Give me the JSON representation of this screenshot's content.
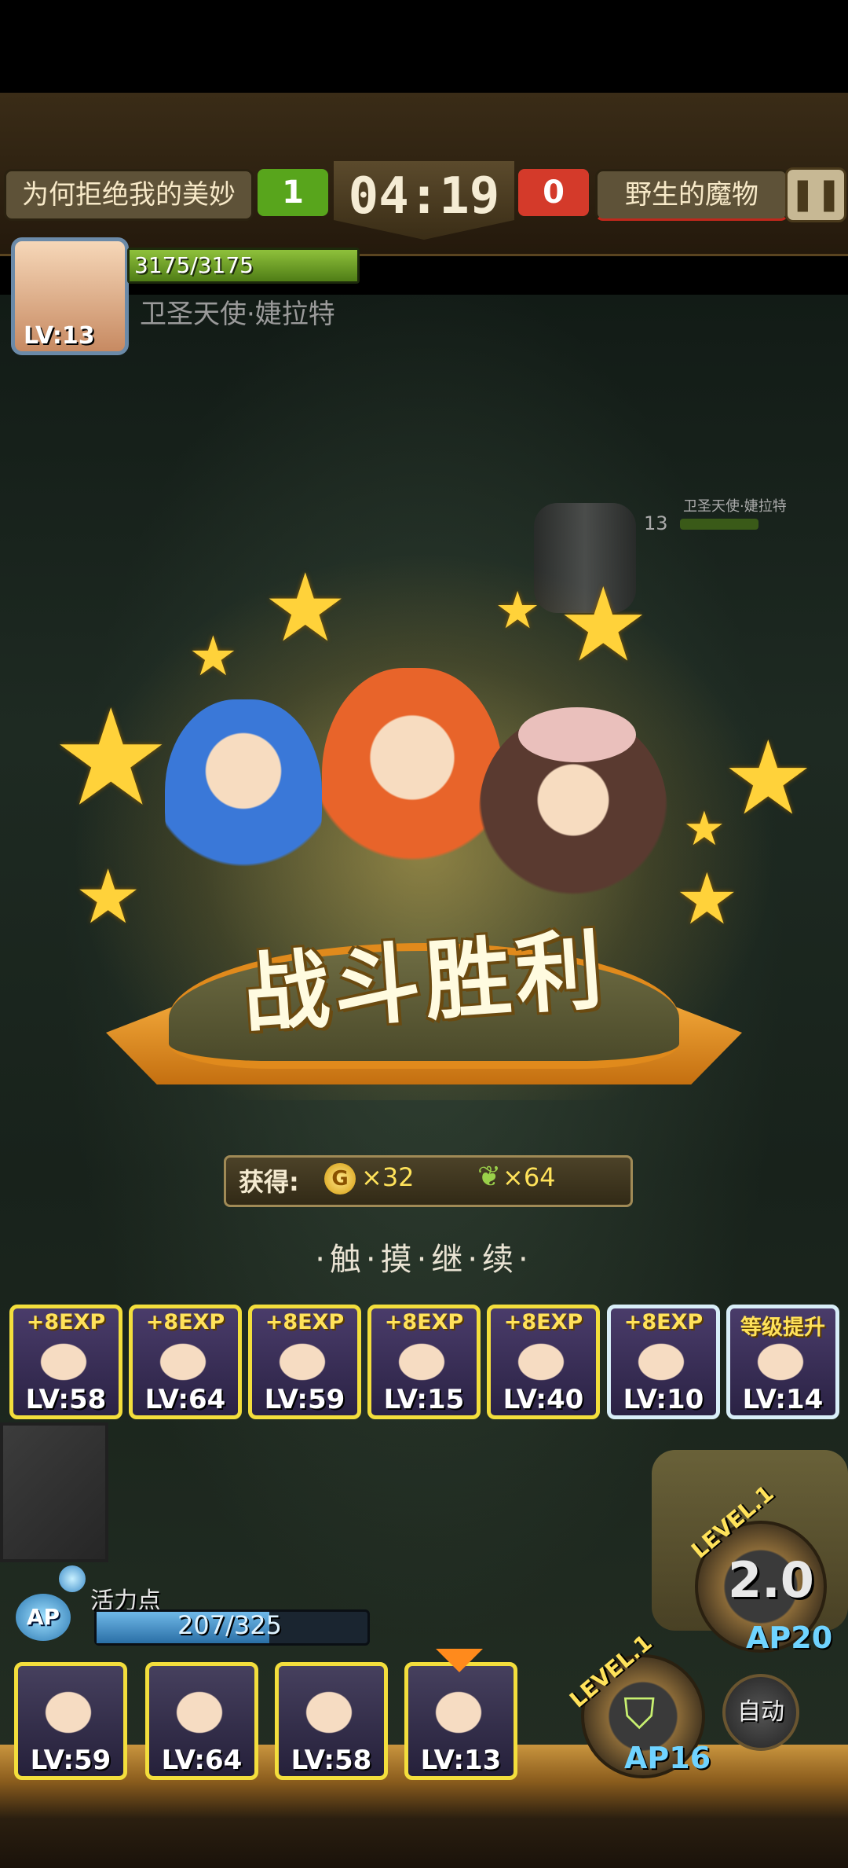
{
  "hud": {
    "left_team": "为何拒绝我的美妙",
    "left_score": "1",
    "timer": "04:19",
    "right_score": "0",
    "right_team": "野生的魔物",
    "pause_icon": "pause-icon"
  },
  "boss": {
    "hp": "3175/3175",
    "hp_fraction": 1.0,
    "name": "卫圣天使·婕拉特",
    "level": "LV:13",
    "field_level": "13",
    "field_name": "卫圣天使·婕拉特"
  },
  "victory": {
    "title": "战斗胜利",
    "reward_label": "获得:",
    "coin_icon": "G",
    "coin_amount": "×32",
    "feather_amount": "×64",
    "touch_continue": "·触·摸·继·续·"
  },
  "exp_cards": [
    {
      "label": "+8EXP",
      "level": "LV:58",
      "border": "gold"
    },
    {
      "label": "+8EXP",
      "level": "LV:64",
      "border": "gold"
    },
    {
      "label": "+8EXP",
      "level": "LV:59",
      "border": "gold"
    },
    {
      "label": "+8EXP",
      "level": "LV:15",
      "border": "gold"
    },
    {
      "label": "+8EXP",
      "level": "LV:40",
      "border": "gold"
    },
    {
      "label": "+8EXP",
      "level": "LV:10",
      "border": "silver"
    },
    {
      "label": "等级提升",
      "level": "LV:14",
      "border": "silver"
    }
  ],
  "ap": {
    "title": "活力点",
    "badge": "AP",
    "value": "207/325",
    "fraction": 0.637
  },
  "party": [
    {
      "level": "LV:59"
    },
    {
      "level": "LV:64"
    },
    {
      "level": "LV:58"
    },
    {
      "level": "LV:13"
    }
  ],
  "controls": {
    "speed_level": "LEVEL.1",
    "speed": "2.0",
    "speed_ap": "AP20",
    "skill_level": "LEVEL.1",
    "skill_ap": "AP16",
    "auto": "自动"
  },
  "colors": {
    "gold_border": "#f3de3c",
    "silver_border": "#d8eef8",
    "hp_green": "#8fc13b",
    "ap_blue": "#6fb8e8",
    "ribbon_orange": "#e08a1c"
  }
}
